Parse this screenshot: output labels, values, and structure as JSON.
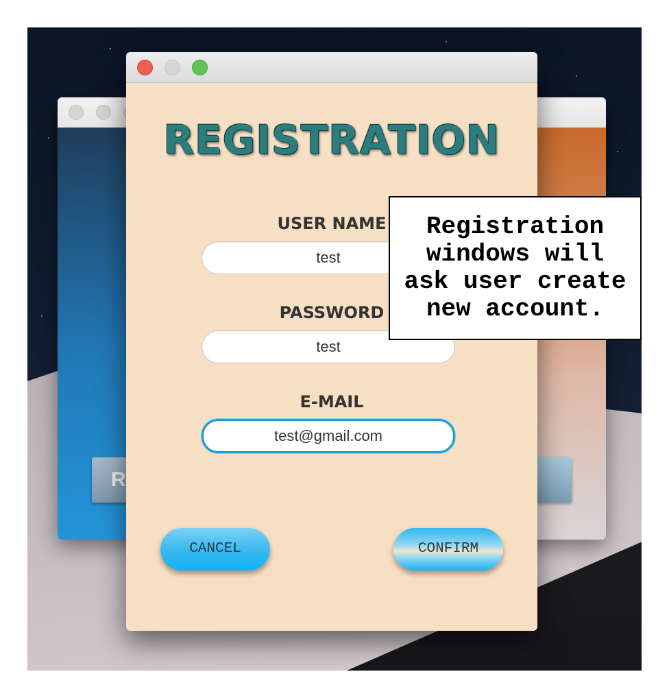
{
  "back_window": {
    "button_left_label": "R"
  },
  "registration": {
    "title": "REGISTRATION",
    "username": {
      "label": "USER NAME",
      "value": "test"
    },
    "password": {
      "label": "PASSWORD",
      "value": "test"
    },
    "email": {
      "label": "E-MAIL",
      "value": "test@gmail.com"
    },
    "cancel_label": "CANCEL",
    "confirm_label": "CONFIRM"
  },
  "annotation": {
    "text": "Registration windows will ask user create new account."
  },
  "colors": {
    "window_bg": "#f7dfc3",
    "title_color": "#2d7d80",
    "accent_blue": "#1d9ad8",
    "close": "#ee5f56",
    "maximize": "#5fc453"
  }
}
